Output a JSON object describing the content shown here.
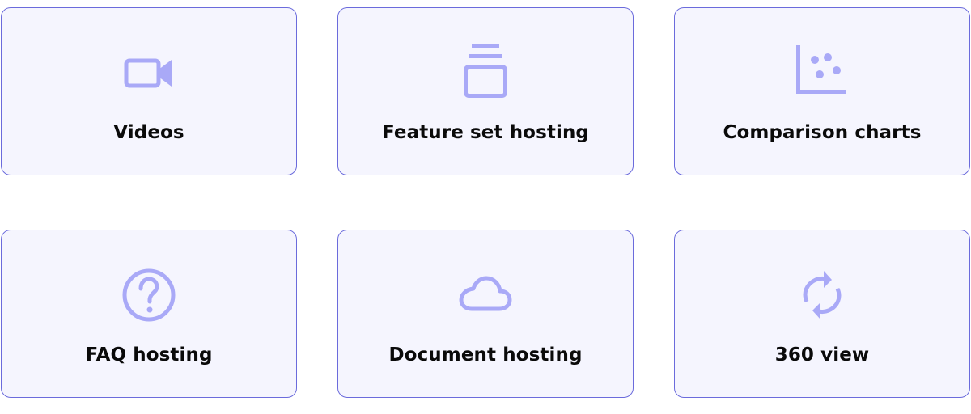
{
  "theme": {
    "card_background": "#f5f5fe",
    "card_border": "#6b6bdc",
    "icon_color": "#a9a9f7",
    "label_color": "#0a0a0a"
  },
  "cards": [
    {
      "label": "Videos",
      "icon": "video-camera-icon"
    },
    {
      "label": "Feature set hosting",
      "icon": "stacked-layers-icon"
    },
    {
      "label": "Comparison charts",
      "icon": "scatter-chart-icon"
    },
    {
      "label": "FAQ hosting",
      "icon": "question-circle-icon"
    },
    {
      "label": "Document hosting",
      "icon": "cloud-icon"
    },
    {
      "label": "360 view",
      "icon": "refresh-arrows-icon"
    }
  ]
}
